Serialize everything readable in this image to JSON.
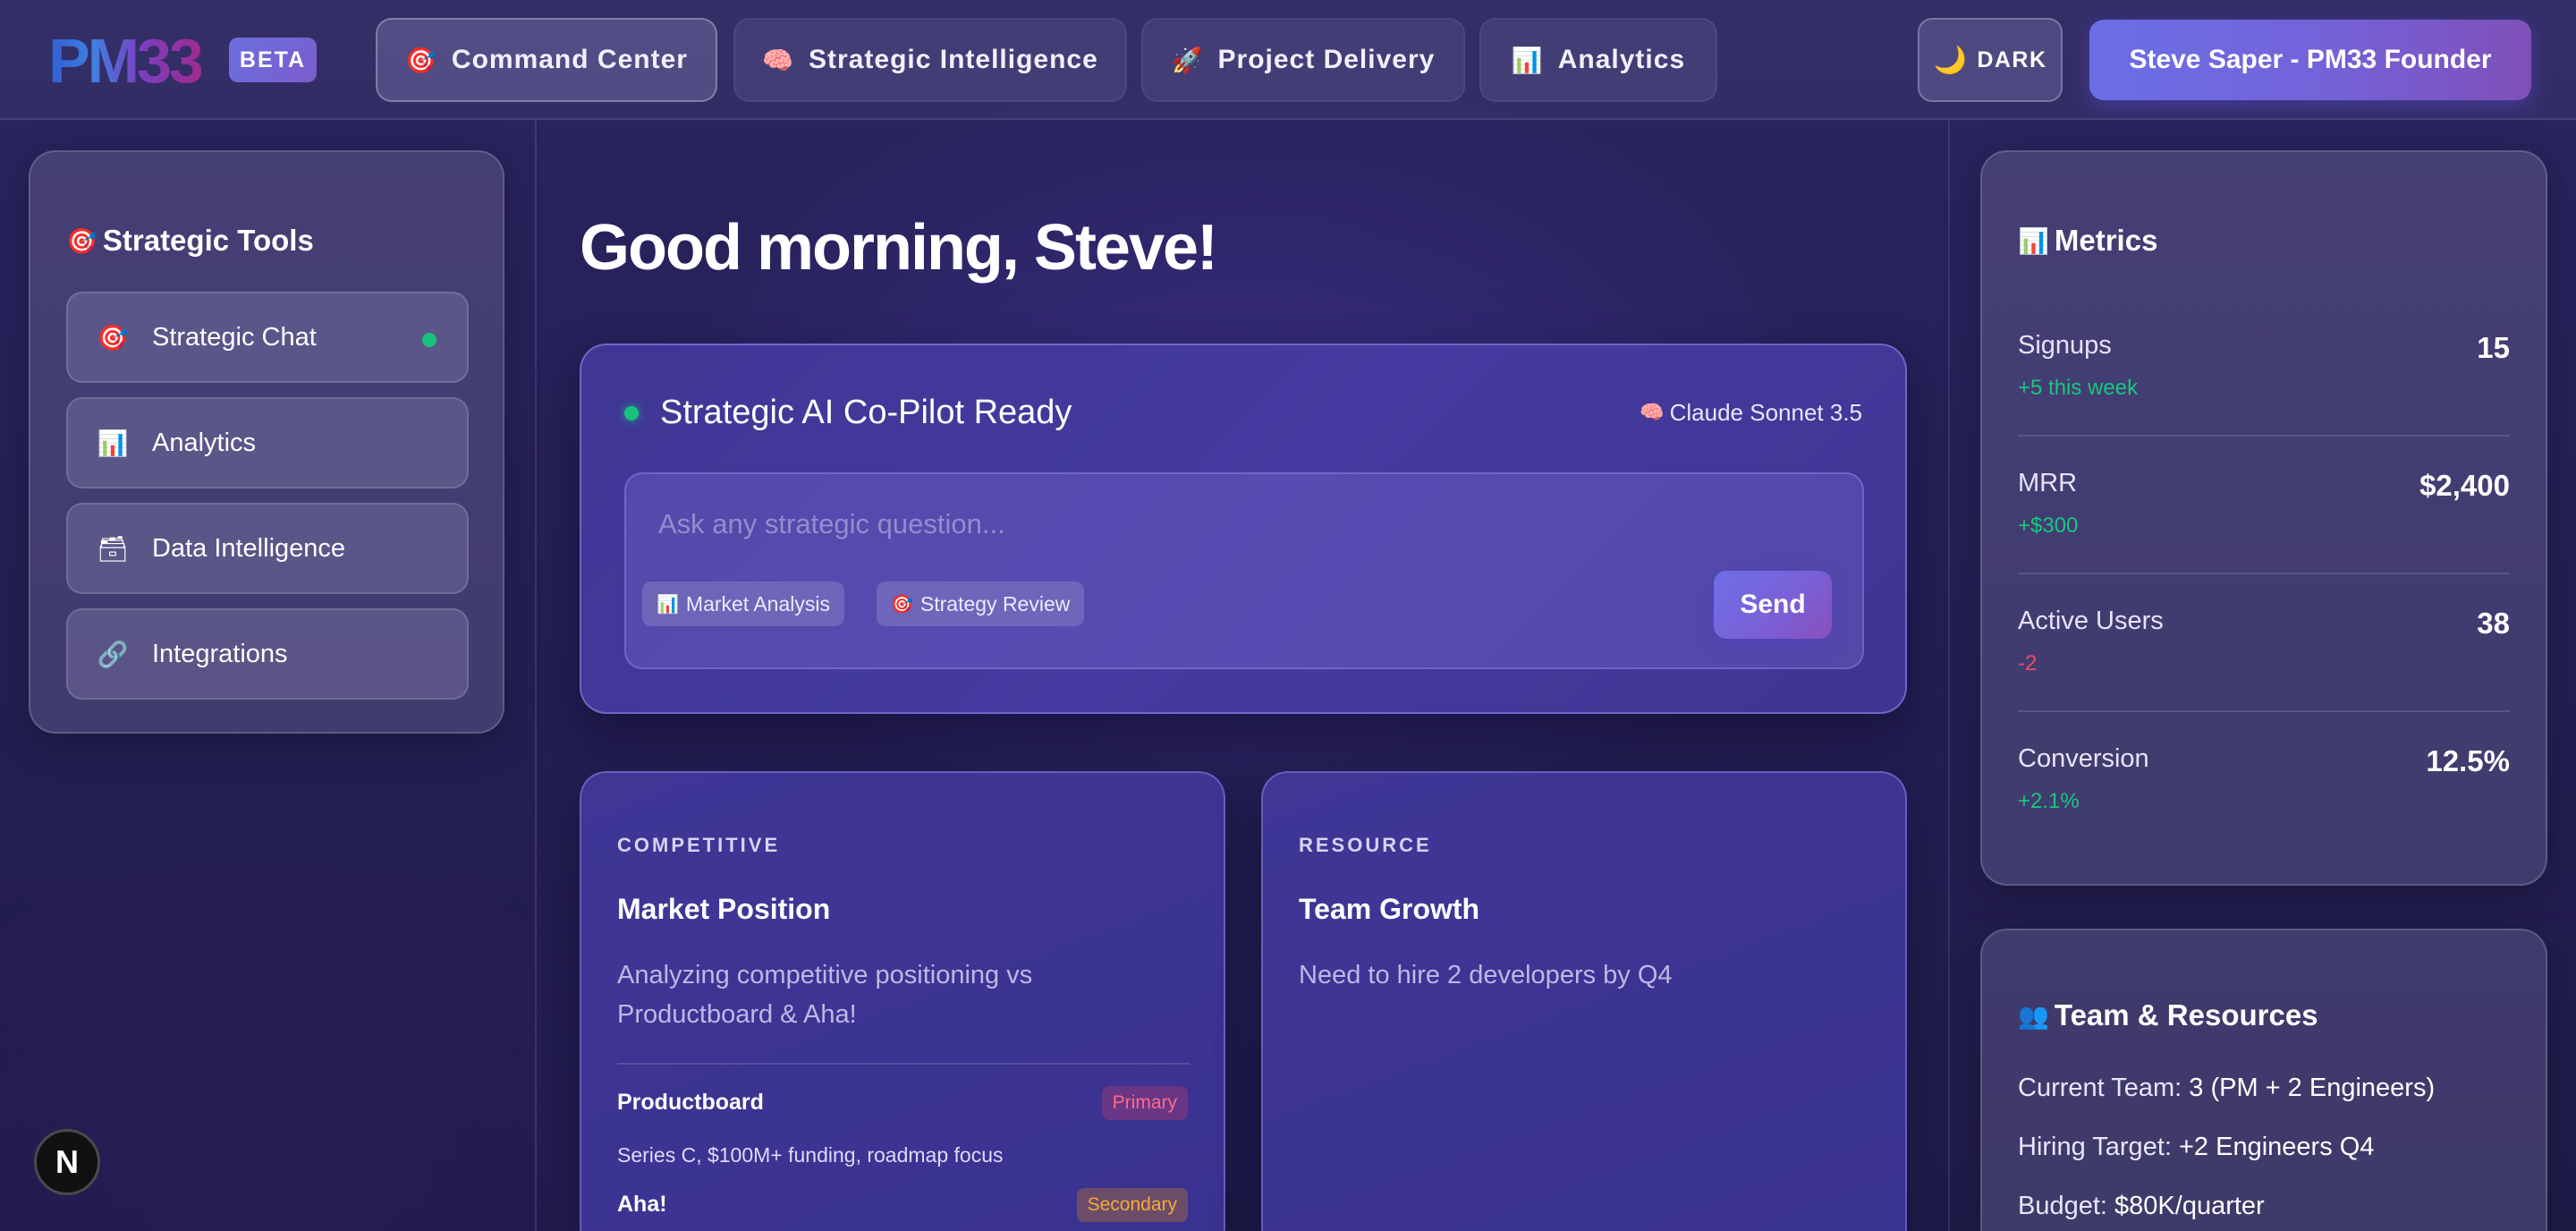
{
  "header": {
    "logo": "PM33",
    "badge": "BETA",
    "nav": [
      {
        "icon": "🎯",
        "icon_name": "target-icon",
        "label": "Command Center",
        "active": true
      },
      {
        "icon": "🧠",
        "icon_name": "brain-icon",
        "label": "Strategic Intelligence",
        "active": false
      },
      {
        "icon": "🚀",
        "icon_name": "rocket-icon",
        "label": "Project Delivery",
        "active": false
      },
      {
        "icon": "📊",
        "icon_name": "bar-chart-icon",
        "label": "Analytics",
        "active": false
      }
    ],
    "theme_toggle": {
      "icon": "🌙",
      "label": "DARK"
    },
    "user_button": "Steve Saper - PM33 Founder"
  },
  "sidebar": {
    "title_icon": "🎯",
    "title": "Strategic Tools",
    "items": [
      {
        "icon": "🎯",
        "label": "Strategic Chat",
        "status": "online"
      },
      {
        "icon": "📊",
        "label": "Analytics"
      },
      {
        "icon": "🗃",
        "label": "Data Intelligence"
      },
      {
        "icon": "🔗",
        "label": "Integrations"
      }
    ]
  },
  "main": {
    "greeting": "Good morning, Steve!",
    "copilot": {
      "title": "Strategic AI Co-Pilot Ready",
      "model_icon": "🧠",
      "model": "Claude Sonnet 3.5",
      "placeholder": "Ask any strategic question...",
      "value": "",
      "chips": [
        {
          "icon": "📊",
          "label": "Market Analysis"
        },
        {
          "icon": "🎯",
          "label": "Strategy Review"
        }
      ],
      "send_label": "Send"
    },
    "cards": [
      {
        "kicker": "COMPETITIVE",
        "title": "Market Position",
        "description": "Analyzing competitive positioning vs Productboard & Aha!",
        "competitors": [
          {
            "name": "Productboard",
            "tag": "Primary",
            "detail": "Series C, $100M+ funding, roadmap focus"
          },
          {
            "name": "Aha!",
            "tag": "Secondary",
            "detail": ""
          }
        ]
      },
      {
        "kicker": "RESOURCE",
        "title": "Team Growth",
        "description": "Need to hire 2 developers by Q4"
      }
    ]
  },
  "metrics": {
    "title_icon": "📊",
    "title": "Metrics",
    "items": [
      {
        "label": "Signups",
        "value": "15",
        "delta": "+5 this week",
        "trend": "up"
      },
      {
        "label": "MRR",
        "value": "$2,400",
        "delta": "+$300",
        "trend": "up"
      },
      {
        "label": "Active Users",
        "value": "38",
        "delta": "-2",
        "trend": "down"
      },
      {
        "label": "Conversion",
        "value": "12.5%",
        "delta": "+2.1%",
        "trend": "up"
      }
    ]
  },
  "team": {
    "title_icon": "👥",
    "title": "Team & Resources",
    "lines": [
      {
        "label": "Current Team:",
        "value": "3 (PM + 2 Engineers)"
      },
      {
        "label": "Hiring Target:",
        "value": "+2 Engineers Q4"
      },
      {
        "label": "Budget:",
        "value": "$80K/quarter"
      }
    ]
  },
  "dev_badge": "N",
  "colors": {
    "accent_gradient_start": "#6b6fe6",
    "accent_gradient_end": "#8a4fb8",
    "positive": "#19c680",
    "negative": "#ef4a63",
    "primary_tag": "#ff6b8b",
    "secondary_tag": "#f5a83a"
  }
}
